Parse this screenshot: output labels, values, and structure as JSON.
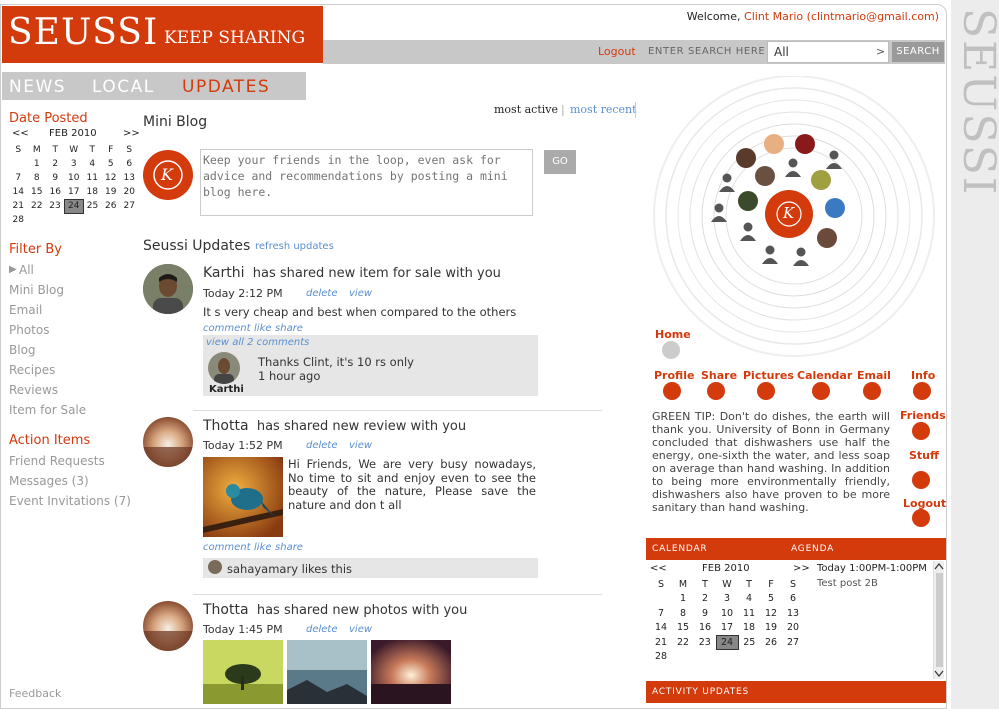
{
  "brand": {
    "name": "SEUSSI",
    "tagline": "KEEP SHARING",
    "side_name": "SEUSSI"
  },
  "header": {
    "welcome_prefix": "Welcome,",
    "user": "Clint Mario (clintmario@gmail.com)",
    "logout": "Logout"
  },
  "search": {
    "label": "ENTER SEARCH HERE",
    "value": "All",
    "arrow": ">",
    "button": "SEARCH"
  },
  "nav": {
    "tabs": [
      {
        "label": "NEWS"
      },
      {
        "label": "LOCAL"
      },
      {
        "label": "UPDATES",
        "active": true
      }
    ]
  },
  "sidebar": {
    "date_heading": "Date Posted",
    "calendar": {
      "prev": "<<",
      "month": "FEB 2010",
      "next": ">>",
      "weekdays": [
        "S",
        "M",
        "T",
        "W",
        "T",
        "F",
        "S"
      ],
      "rows": [
        [
          "",
          "1",
          "2",
          "3",
          "4",
          "5",
          "6"
        ],
        [
          "7",
          "8",
          "9",
          "10",
          "11",
          "12",
          "13"
        ],
        [
          "14",
          "15",
          "16",
          "17",
          "18",
          "19",
          "20"
        ],
        [
          "21",
          "22",
          "23",
          "24",
          "25",
          "26",
          "27"
        ],
        [
          "28",
          "",
          "",
          "",
          "",
          "",
          ""
        ]
      ],
      "selected": "24"
    },
    "filter_heading": "Filter By",
    "filters": [
      "All",
      "Mini Blog",
      "Email",
      "Photos",
      "Blog",
      "Recipes",
      "Reviews",
      "Item for Sale"
    ],
    "action_heading": "Action Items",
    "actions": [
      "Friend Requests",
      "Messages (3)",
      "Event Invitations (7)"
    ],
    "feedback": "Feedback"
  },
  "sort": {
    "active": "most active",
    "separator": "|",
    "recent": "most recent"
  },
  "miniblog": {
    "title": "Mini Blog",
    "placeholder": "Keep your friends in the loop, even ask for advice and recommendations by posting a mini blog here.",
    "go": "GO",
    "avatar_letter": "K"
  },
  "updates": {
    "title": "Seussi Updates",
    "refresh": "refresh updates",
    "items": [
      {
        "name": "Karthi",
        "action": "has shared new item for sale with you",
        "time": "Today 2:12 PM",
        "delete": "delete",
        "view": "view",
        "text": "It s very cheap and best when compared to the others",
        "links": [
          "comment",
          "like",
          "share"
        ],
        "view_all": "view all 2 comments",
        "comment_text": "Thanks Clint, it's 10 rs only",
        "comment_time": "1 hour ago",
        "comment_author": "Karthi"
      },
      {
        "name": "Thotta",
        "action": "has shared new review with you",
        "time": "Today 1:52 PM",
        "delete": "delete",
        "view": "view",
        "text": "Hi Friends, We are very busy nowadays, No time to sit and enjoy even to see the beauty of the nature, Please save the nature and don t all",
        "links": [
          "comment",
          "like",
          "share"
        ],
        "likes": "sahayamary likes this"
      },
      {
        "name": "Thotta",
        "action": "has shared new photos with you",
        "time": "Today 1:45 PM",
        "delete": "delete",
        "view": "view"
      }
    ]
  },
  "dock": {
    "home": "Home",
    "items": [
      "Profile",
      "Share",
      "Pictures",
      "Calendar",
      "Email",
      "Info"
    ],
    "right": [
      "Friends",
      "Stuff",
      "Logout"
    ],
    "center_letter": "K"
  },
  "tip": {
    "text": "GREEN TIP: Don't do dishes, the earth will thank you. University of Bonn in Germany concluded that dishwashers use half the energy, one-sixth the water, and less soap on average than hand washing. In addition to being more environmentally friendly, dishwashers also have proven to be more sanitary than hand washing."
  },
  "calendar_panel": {
    "calendar_label": "CALENDAR",
    "agenda_label": "AGENDA",
    "prev": "<<",
    "month": "FEB 2010",
    "next": ">>",
    "agenda_time": "Today 1:00PM-1:00PM",
    "agenda_item": "Test post 2B",
    "activity_label": "ACTIVITY UPDATES"
  },
  "colors": {
    "brand": "#d33a0c",
    "bar": "#c8c8c8",
    "link": "#5a8fd0"
  }
}
